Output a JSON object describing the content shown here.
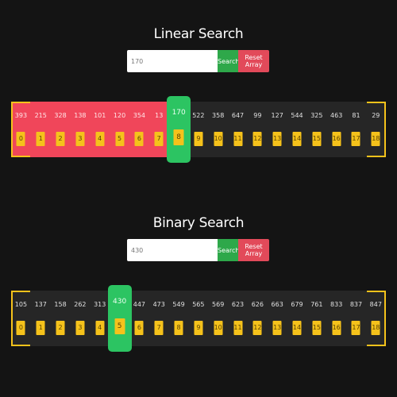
{
  "linear": {
    "title": "Linear Search",
    "input_value": "170",
    "search_label": "Search",
    "reset_label": "Reset Array",
    "values": [
      "393",
      "215",
      "328",
      "138",
      "101",
      "120",
      "354",
      "13",
      "170",
      "522",
      "358",
      "647",
      "99",
      "127",
      "544",
      "325",
      "463",
      "81",
      "29"
    ],
    "indices": [
      "0",
      "1",
      "2",
      "3",
      "4",
      "5",
      "6",
      "7",
      "8",
      "9",
      "10",
      "11",
      "12",
      "13",
      "14",
      "15",
      "16",
      "17",
      "18"
    ],
    "visited_count": 8,
    "current_index": 8
  },
  "binary": {
    "title": "Binary Search",
    "input_value": "430",
    "search_label": "Search",
    "reset_label": "Reset Array",
    "values": [
      "105",
      "137",
      "158",
      "262",
      "313",
      "430",
      "447",
      "473",
      "549",
      "565",
      "569",
      "623",
      "626",
      "663",
      "679",
      "761",
      "833",
      "837",
      "847"
    ],
    "indices": [
      "0",
      "1",
      "2",
      "3",
      "4",
      "5",
      "6",
      "7",
      "8",
      "9",
      "10",
      "11",
      "12",
      "13",
      "14",
      "15",
      "16",
      "17",
      "18"
    ],
    "visited_count": 0,
    "current_index": 5
  },
  "colors": {
    "background": "#141414",
    "visited": "#f0465a",
    "current": "#2cc462",
    "index_badge": "#f5c21b",
    "search_button": "#2ea84a",
    "reset_button": "#e24a5a"
  }
}
